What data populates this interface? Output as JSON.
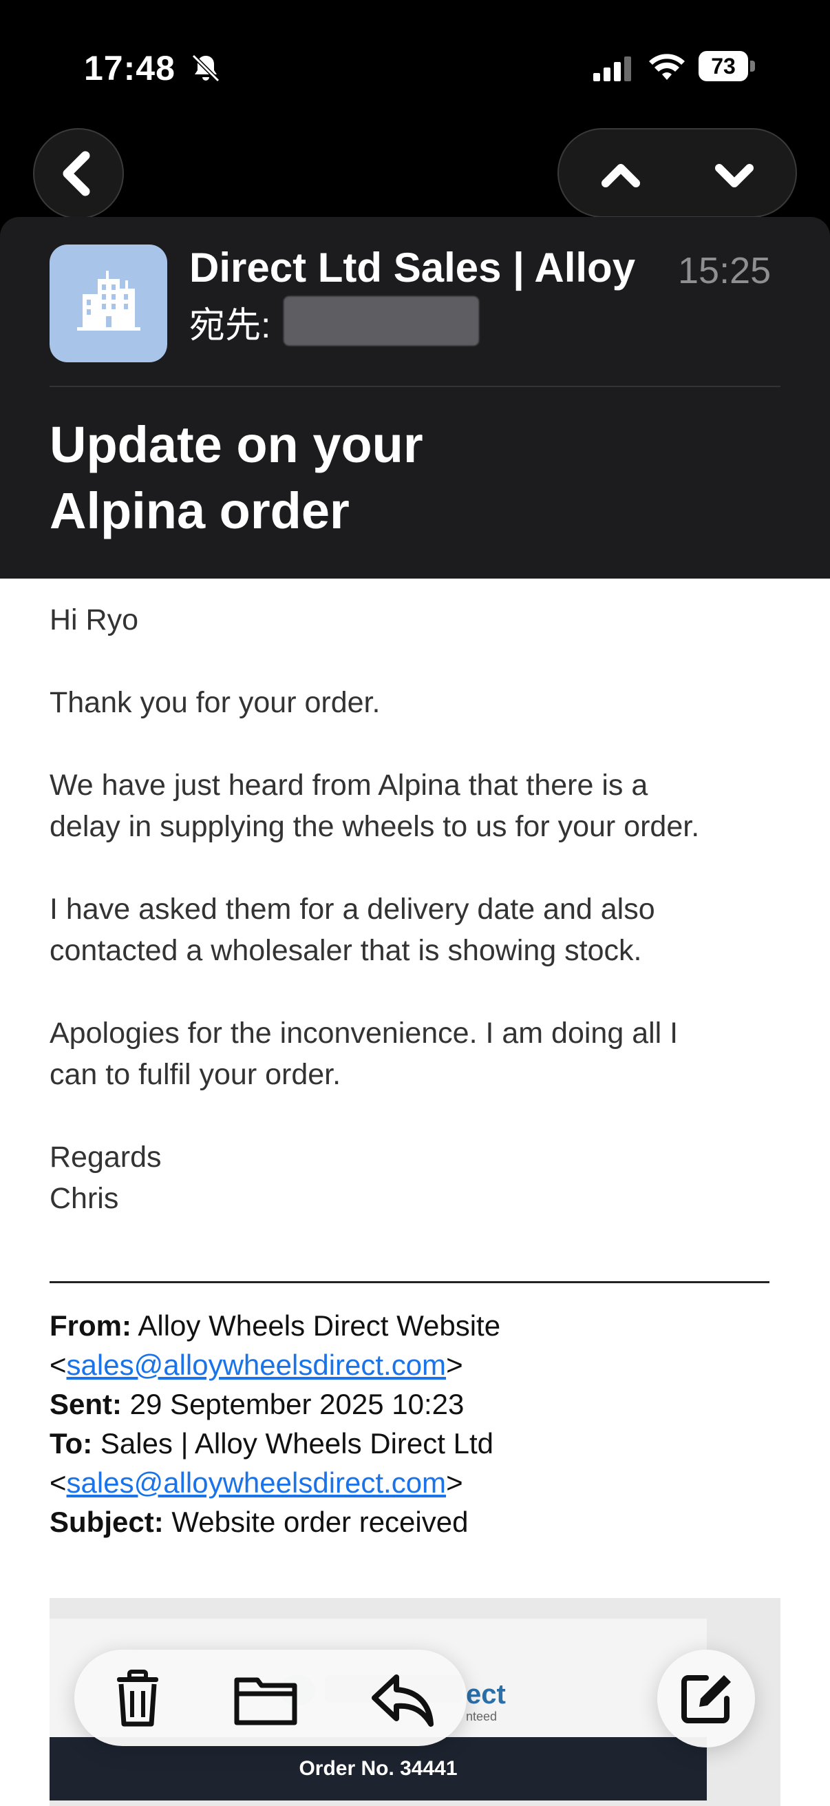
{
  "status_bar": {
    "time": "17:48",
    "battery": "73"
  },
  "header": {
    "sender": "Direct Ltd Sales | Alloy",
    "time": "15:25",
    "to_label": "宛先:",
    "subject_line1": "Update on your",
    "subject_line2": "Alpina order"
  },
  "body": {
    "greeting": "Hi Ryo",
    "p1": "Thank you for your order.",
    "p2a": "We have just heard from Alpina that there is a",
    "p2b": "delay in supplying the wheels to us for your order.",
    "p3a": "I have asked them for a delivery date and also",
    "p3b": "contacted a wholesaler that is showing stock.",
    "p4a": "Apologies for the inconvenience. I am doing all I",
    "p4b": "can to fulfil your order.",
    "regards": "Regards",
    "name": "Chris"
  },
  "quoted": {
    "from_label": "From:",
    "from_value": "Alloy Wheels Direct Website",
    "from_email": "sales@alloywheelsdirect.com",
    "sent_label": "Sent:",
    "sent_value": "29 September 2025 10:23",
    "to_label": "To:",
    "to_value": "Sales | Alloy Wheels Direct Ltd",
    "to_email": "sales@alloywheelsdirect.com",
    "subject_label": "Subject:",
    "subject_value": "Website order received"
  },
  "embed": {
    "logo_text": "ect",
    "logo_sub": "nteed",
    "order_no": "Order No. 34441"
  },
  "icons": [
    "chevron-left-icon",
    "chevron-up-icon",
    "chevron-down-icon",
    "building-icon",
    "trash-icon",
    "folder-icon",
    "reply-icon",
    "compose-icon"
  ]
}
